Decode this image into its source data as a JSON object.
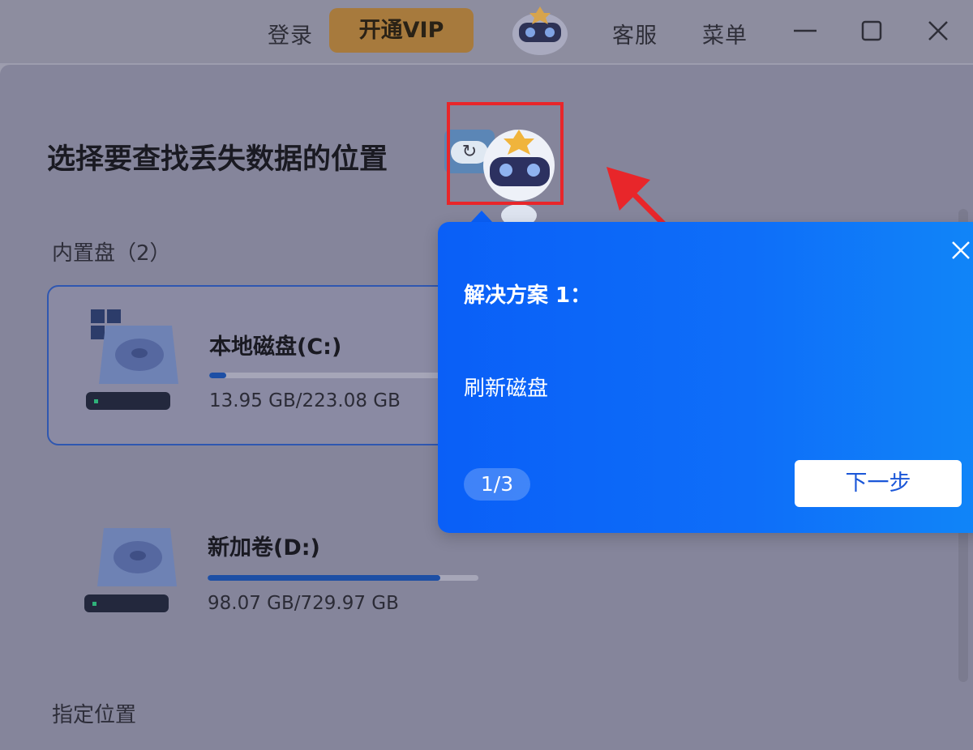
{
  "titlebar": {
    "login_label": "登录",
    "vip_label": "开通VIP",
    "support_label": "客服",
    "menu_label": "菜单",
    "minimize_icon": "minimize-icon",
    "maximize_icon": "maximize-icon",
    "close_icon": "close-icon",
    "vip_color": "#a77a3d"
  },
  "main": {
    "title": "选择要查找丢失数据的位置",
    "internal_section_label": "内置盘（2）",
    "specified_location_label": "指定位置",
    "refresh_icon": "refresh-icon",
    "disks": [
      {
        "name": "本地磁盘(C:)",
        "size_text": "13.95 GB/223.08 GB",
        "usage_fraction": 0.0625,
        "has_windows_logo": true,
        "selected": true
      },
      {
        "name": "新加卷(D:)",
        "size_text": "98.07 GB/729.97 GB",
        "usage_fraction": 0.86,
        "has_windows_logo": false,
        "selected": false
      }
    ]
  },
  "guide": {
    "title": "解决方案 1：",
    "body": "刷新磁盘",
    "step_indicator": "1/3",
    "next_label": "下一步",
    "close_icon": "close-icon",
    "accent": "#0a5ff7"
  },
  "annotation": {
    "highlight_color": "#e8262a"
  }
}
